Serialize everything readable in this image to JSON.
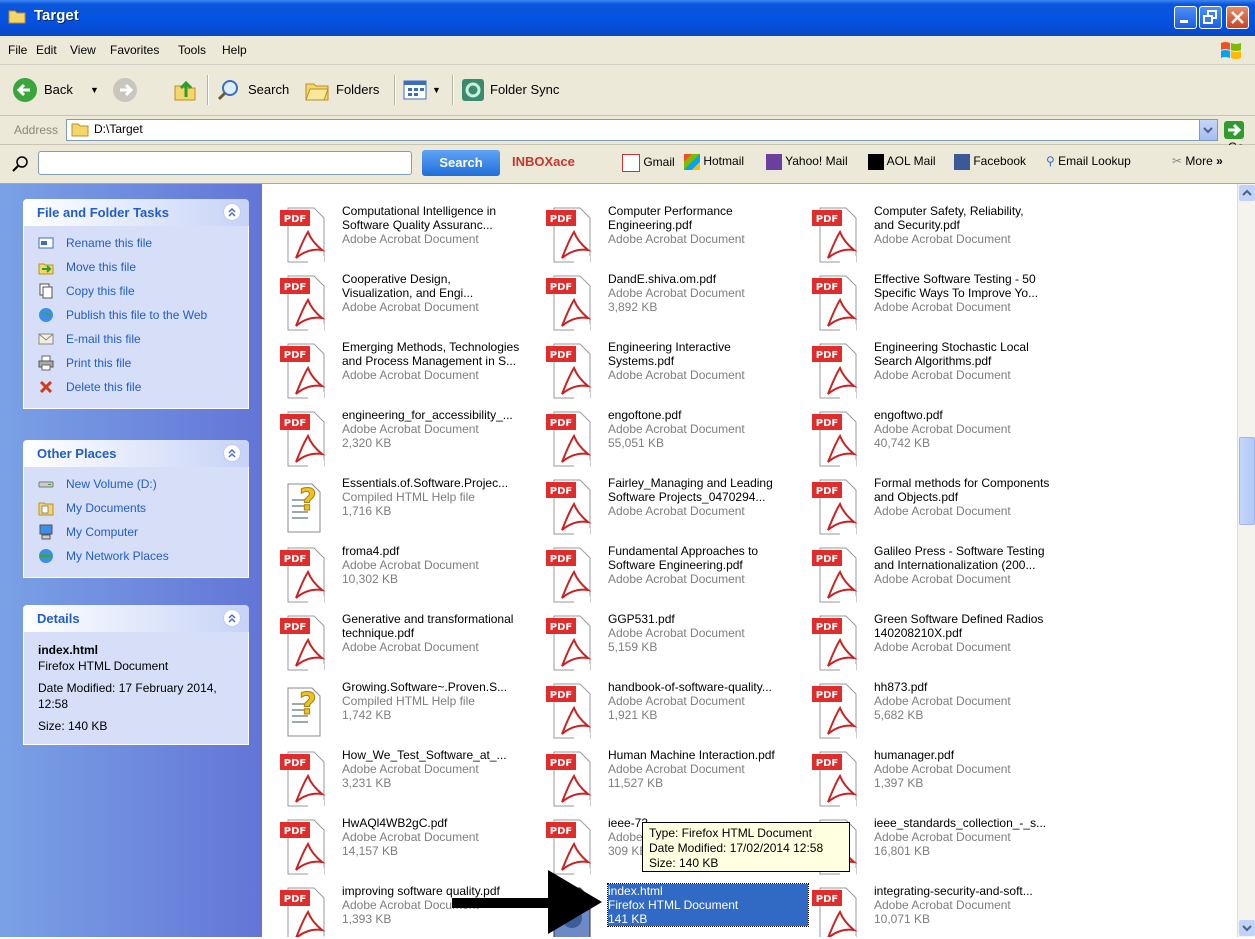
{
  "window": {
    "title": "Target"
  },
  "menu": [
    "File",
    "Edit",
    "View",
    "Favorites",
    "Tools",
    "Help"
  ],
  "toolbar": {
    "back": "Back",
    "search": "Search",
    "folders": "Folders",
    "folder_sync": "Folder Sync"
  },
  "address": {
    "label": "Address",
    "value": "D:\\Target",
    "go": "Go"
  },
  "searchbar": {
    "button": "Search",
    "inboxace": "INBOXace",
    "links": [
      "Gmail",
      "Hotmail",
      "Yahoo! Mail",
      "AOL Mail",
      "Facebook",
      "Email Lookup"
    ],
    "more": "More"
  },
  "tasks": {
    "title": "File and Folder Tasks",
    "items": [
      "Rename this file",
      "Move this file",
      "Copy this file",
      "Publish this file to the Web",
      "E-mail this file",
      "Print this file",
      "Delete this file"
    ]
  },
  "places": {
    "title": "Other Places",
    "items": [
      "New Volume (D:)",
      "My Documents",
      "My Computer",
      "My Network Places"
    ]
  },
  "details": {
    "title": "Details",
    "name": "index.html",
    "type": "Firefox HTML Document",
    "modified": "Date Modified: 17 February 2014, 12:58",
    "size": "Size: 140 KB"
  },
  "files": [
    {
      "icon": "pdf",
      "l1": "Computational Intelligence in",
      "l2": "Software Quality Assuranc...",
      "l3": "Adobe Acrobat Document"
    },
    {
      "icon": "pdf",
      "l1": "Computer Performance",
      "l2": "Engineering.pdf",
      "l3": "Adobe Acrobat Document"
    },
    {
      "icon": "pdf",
      "l1": "Computer Safety, Reliability,",
      "l2": "and Security.pdf",
      "l3": "Adobe Acrobat Document"
    },
    {
      "icon": "pdf",
      "l1": "Cooperative Design,",
      "l2": "Visualization, and Engi...",
      "l3": "Adobe Acrobat Document"
    },
    {
      "icon": "pdf",
      "l1": "DandE.shiva.om.pdf",
      "l2": "Adobe Acrobat Document",
      "l3": "3,892 KB"
    },
    {
      "icon": "pdf",
      "l1": "Effective Software Testing - 50",
      "l2": "Specific Ways To Improve Yo...",
      "l3": "Adobe Acrobat Document"
    },
    {
      "icon": "pdf",
      "l1": "Emerging Methods, Technologies",
      "l2": "and Process Management in S...",
      "l3": "Adobe Acrobat Document"
    },
    {
      "icon": "pdf",
      "l1": "Engineering Interactive",
      "l2": "Systems.pdf",
      "l3": "Adobe Acrobat Document"
    },
    {
      "icon": "pdf",
      "l1": "Engineering Stochastic Local",
      "l2": "Search Algorithms.pdf",
      "l3": "Adobe Acrobat Document"
    },
    {
      "icon": "pdf",
      "l1": "engineering_for_accessibility_...",
      "l2": "Adobe Acrobat Document",
      "l3": "2,320 KB"
    },
    {
      "icon": "pdf",
      "l1": "engoftone.pdf",
      "l2": "Adobe Acrobat Document",
      "l3": "55,051 KB"
    },
    {
      "icon": "pdf",
      "l1": "engoftwo.pdf",
      "l2": "Adobe Acrobat Document",
      "l3": "40,742 KB"
    },
    {
      "icon": "chm",
      "l1": "Essentials.of.Software.Projec...",
      "l2": "Compiled HTML Help file",
      "l3": "1,716 KB"
    },
    {
      "icon": "pdf",
      "l1": "Fairley_Managing and Leading",
      "l2": "Software Projects_0470294...",
      "l3": "Adobe Acrobat Document"
    },
    {
      "icon": "pdf",
      "l1": "Formal methods for Components",
      "l2": "and Objects.pdf",
      "l3": "Adobe Acrobat Document"
    },
    {
      "icon": "pdf",
      "l1": "froma4.pdf",
      "l2": "Adobe Acrobat Document",
      "l3": "10,302 KB"
    },
    {
      "icon": "pdf",
      "l1": "Fundamental Approaches to",
      "l2": "Software Engineering.pdf",
      "l3": "Adobe Acrobat Document"
    },
    {
      "icon": "pdf",
      "l1": "Galileo Press - Software Testing",
      "l2": "and Internationalization (200...",
      "l3": "Adobe Acrobat Document"
    },
    {
      "icon": "pdf",
      "l1": "Generative and transformational",
      "l2": "technique.pdf",
      "l3": "Adobe Acrobat Document"
    },
    {
      "icon": "pdf",
      "l1": "GGP531.pdf",
      "l2": "Adobe Acrobat Document",
      "l3": "5,159 KB"
    },
    {
      "icon": "pdf",
      "l1": "Green Software Defined Radios",
      "l2": "140208210X.pdf",
      "l3": "Adobe Acrobat Document"
    },
    {
      "icon": "chm",
      "l1": "Growing.Software~.Proven.S...",
      "l2": "Compiled HTML Help file",
      "l3": "1,742 KB"
    },
    {
      "icon": "pdf",
      "l1": "handbook-of-software-quality...",
      "l2": "Adobe Acrobat Document",
      "l3": "1,921 KB"
    },
    {
      "icon": "pdf",
      "l1": "hh873.pdf",
      "l2": "Adobe Acrobat Document",
      "l3": "5,682 KB"
    },
    {
      "icon": "pdf",
      "l1": "How_We_Test_Software_at_...",
      "l2": "Adobe Acrobat Document",
      "l3": "3,231 KB"
    },
    {
      "icon": "pdf",
      "l1": "Human Machine Interaction.pdf",
      "l2": "Adobe Acrobat Document",
      "l3": "11,527 KB"
    },
    {
      "icon": "pdf",
      "l1": "humanager.pdf",
      "l2": "Adobe Acrobat Document",
      "l3": "1,397 KB"
    },
    {
      "icon": "pdf",
      "l1": "HwAQl4WB2gC.pdf",
      "l2": "Adobe Acrobat Document",
      "l3": "14,157 KB"
    },
    {
      "icon": "pdf",
      "l1": "ieee-73",
      "l2": "Adobe",
      "l3": "309 KB"
    },
    {
      "icon": "pdf",
      "l1": "ieee_standards_collection_-_s...",
      "l2": "Adobe Acrobat Document",
      "l3": "16,801 KB"
    },
    {
      "icon": "pdf",
      "l1": "improving software quality.pdf",
      "l2": "Adobe Acrobat Document",
      "l3": "1,393 KB"
    },
    {
      "icon": "html",
      "l1": "index.html",
      "l2": "Firefox HTML Document",
      "l3": "141 KB",
      "selected": true
    },
    {
      "icon": "pdf",
      "l1": "integrating-security-and-soft...",
      "l2": "Adobe Acrobat Document",
      "l3": "10,071 KB"
    }
  ],
  "tooltip": {
    "type": "Type: Firefox HTML Document",
    "modified": "Date Modified: 17/02/2014 12:58",
    "size": "Size: 140 KB"
  }
}
